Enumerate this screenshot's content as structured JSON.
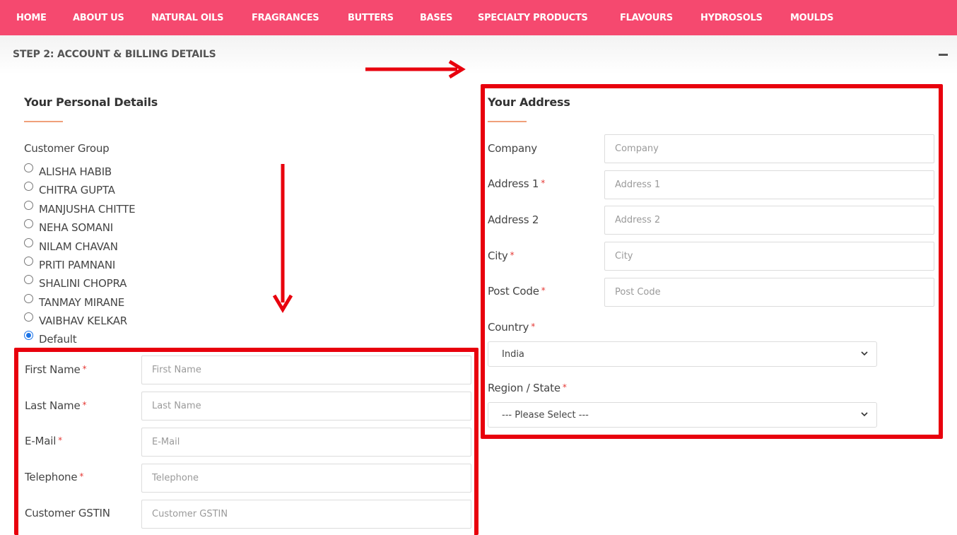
{
  "nav": {
    "items": [
      "HOME",
      "ABOUT US",
      "NATURAL OILS",
      "FRAGRANCES",
      "BUTTERS",
      "BASES",
      "SPECIALTY PRODUCTS",
      "FLAVOURS",
      "HYDROSOLS",
      "MOULDS"
    ]
  },
  "step": {
    "title": "STEP 2: ACCOUNT & BILLING DETAILS"
  },
  "personal": {
    "title": "Your Personal Details",
    "customer_group_label": "Customer Group",
    "groups": [
      "ALISHA HABIB",
      "CHITRA GUPTA",
      "MANJUSHA CHITTE",
      "NEHA SOMANI",
      "NILAM CHAVAN",
      "PRITI PAMNANI",
      "SHALINI CHOPRA",
      "TANMAY MIRANE",
      "VAIBHAV KELKAR",
      "Default"
    ],
    "selected_group": "Default",
    "fields": [
      {
        "label": "First Name",
        "required": "*",
        "placeholder": "First Name",
        "value": ""
      },
      {
        "label": "Last Name",
        "required": "*",
        "placeholder": "Last Name",
        "value": ""
      },
      {
        "label": "E-Mail",
        "required": "*",
        "placeholder": "E-Mail",
        "value": ""
      },
      {
        "label": "Telephone",
        "required": "*",
        "placeholder": "Telephone",
        "value": ""
      },
      {
        "label": "Customer GSTIN",
        "required": "",
        "placeholder": "Customer GSTIN",
        "value": ""
      }
    ]
  },
  "address": {
    "title": "Your Address",
    "fields": [
      {
        "label": "Company",
        "required": "",
        "placeholder": "Company",
        "value": ""
      },
      {
        "label": "Address 1",
        "required": "*",
        "placeholder": "Address 1",
        "value": ""
      },
      {
        "label": "Address 2",
        "required": "",
        "placeholder": "Address 2",
        "value": ""
      },
      {
        "label": "City",
        "required": "*",
        "placeholder": "City",
        "value": ""
      },
      {
        "label": "Post Code",
        "required": "*",
        "placeholder": "Post Code",
        "value": ""
      }
    ],
    "country": {
      "label": "Country",
      "required": "*",
      "value": "India"
    },
    "region": {
      "label": "Region / State",
      "required": "*",
      "value": "--- Please Select ---"
    }
  },
  "colors": {
    "nav_bg": "#f5496f",
    "annotation": "#e8000d",
    "required": "#e53935",
    "title_underline": "#f0a07a"
  },
  "icons": {
    "collapse": "minus-icon",
    "dropdown": "chevron-down-icon",
    "annotation_arrow": "arrow-icon"
  }
}
